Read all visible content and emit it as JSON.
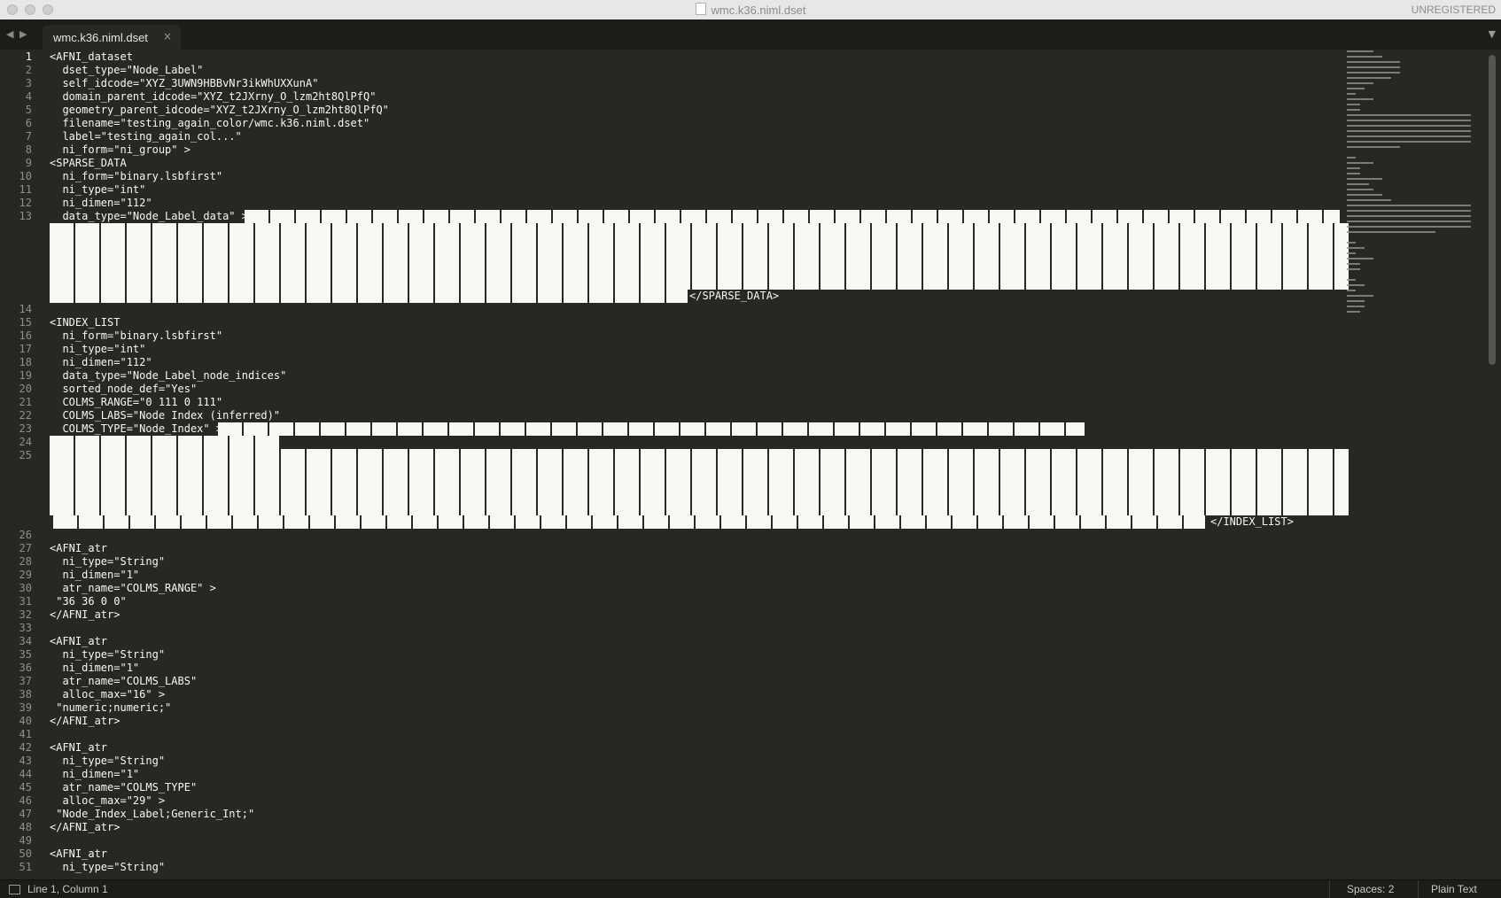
{
  "window": {
    "title": "wmc.k36.niml.dset",
    "registration": "UNREGISTERED"
  },
  "tab": {
    "label": "wmc.k36.niml.dset",
    "close": "×"
  },
  "nav": {
    "back": "◀",
    "forward": "▶",
    "menu": "▼"
  },
  "lines": [
    {
      "n": "1",
      "text": "<AFNI_dataset"
    },
    {
      "n": "2",
      "text": "  dset_type=\"Node_Label\""
    },
    {
      "n": "3",
      "text": "  self_idcode=\"XYZ_3UWN9HBBvNr3ikWhUXXunA\""
    },
    {
      "n": "4",
      "text": "  domain_parent_idcode=\"XYZ_t2JXrny_O_lzm2ht8QlPfQ\""
    },
    {
      "n": "5",
      "text": "  geometry_parent_idcode=\"XYZ_t2JXrny_O_lzm2ht8QlPfQ\""
    },
    {
      "n": "6",
      "text": "  filename=\"testing_again_color/wmc.k36.niml.dset\""
    },
    {
      "n": "7",
      "text": "  label=\"testing_again_col...\""
    },
    {
      "n": "8",
      "text": "  ni_form=\"ni_group\" >"
    },
    {
      "n": "9",
      "text": "<SPARSE_DATA"
    },
    {
      "n": "10",
      "text": "  ni_form=\"binary.lsbfirst\""
    },
    {
      "n": "11",
      "text": "  ni_type=\"int\""
    },
    {
      "n": "12",
      "text": "  ni_dimen=\"112\""
    },
    {
      "n": "13",
      "text": "  data_type=\"Node_Label_data\" >$"
    },
    {
      "n": "14",
      "text": ""
    },
    {
      "n": "15",
      "text": "<INDEX_LIST"
    },
    {
      "n": "16",
      "text": "  ni_form=\"binary.lsbfirst\""
    },
    {
      "n": "17",
      "text": "  ni_type=\"int\""
    },
    {
      "n": "18",
      "text": "  ni_dimen=\"112\""
    },
    {
      "n": "19",
      "text": "  data_type=\"Node_Label_node_indices\""
    },
    {
      "n": "20",
      "text": "  sorted_node_def=\"Yes\""
    },
    {
      "n": "21",
      "text": "  COLMS_RANGE=\"0 111 0 111\""
    },
    {
      "n": "22",
      "text": "  COLMS_LABS=\"Node Index (inferred)\""
    },
    {
      "n": "23",
      "text": "  COLMS_TYPE=\"Node_Index\" >"
    },
    {
      "n": "24",
      "text": ""
    },
    {
      "n": "25",
      "text": ""
    },
    {
      "n": "26",
      "text": ""
    },
    {
      "n": "27",
      "text": "<AFNI_atr"
    },
    {
      "n": "28",
      "text": "  ni_type=\"String\""
    },
    {
      "n": "29",
      "text": "  ni_dimen=\"1\""
    },
    {
      "n": "30",
      "text": "  atr_name=\"COLMS_RANGE\" >"
    },
    {
      "n": "31",
      "text": " \"36 36 0 0\""
    },
    {
      "n": "32",
      "text": "</AFNI_atr>"
    },
    {
      "n": "33",
      "text": ""
    },
    {
      "n": "34",
      "text": "<AFNI_atr"
    },
    {
      "n": "35",
      "text": "  ni_type=\"String\""
    },
    {
      "n": "36",
      "text": "  ni_dimen=\"1\""
    },
    {
      "n": "37",
      "text": "  atr_name=\"COLMS_LABS\""
    },
    {
      "n": "38",
      "text": "  alloc_max=\"16\" >"
    },
    {
      "n": "39",
      "text": " \"numeric;numeric;\""
    },
    {
      "n": "40",
      "text": "</AFNI_atr>"
    },
    {
      "n": "41",
      "text": ""
    },
    {
      "n": "42",
      "text": "<AFNI_atr"
    },
    {
      "n": "43",
      "text": "  ni_type=\"String\""
    },
    {
      "n": "44",
      "text": "  ni_dimen=\"1\""
    },
    {
      "n": "45",
      "text": "  atr_name=\"COLMS_TYPE\""
    },
    {
      "n": "46",
      "text": "  alloc_max=\"29\" >"
    },
    {
      "n": "47",
      "text": " \"Node_Index_Label;Generic_Int;\""
    },
    {
      "n": "48",
      "text": "</AFNI_atr>"
    },
    {
      "n": "49",
      "text": ""
    },
    {
      "n": "50",
      "text": "<AFNI_atr"
    },
    {
      "n": "51",
      "text": "  ni_type=\"String\""
    }
  ],
  "sparse_tail": "</SPARSE_DATA>",
  "index_tail": "</INDEX_LIST>",
  "status": {
    "position": "Line 1, Column 1",
    "indent": "Spaces: 2",
    "syntax": "Plain Text"
  }
}
